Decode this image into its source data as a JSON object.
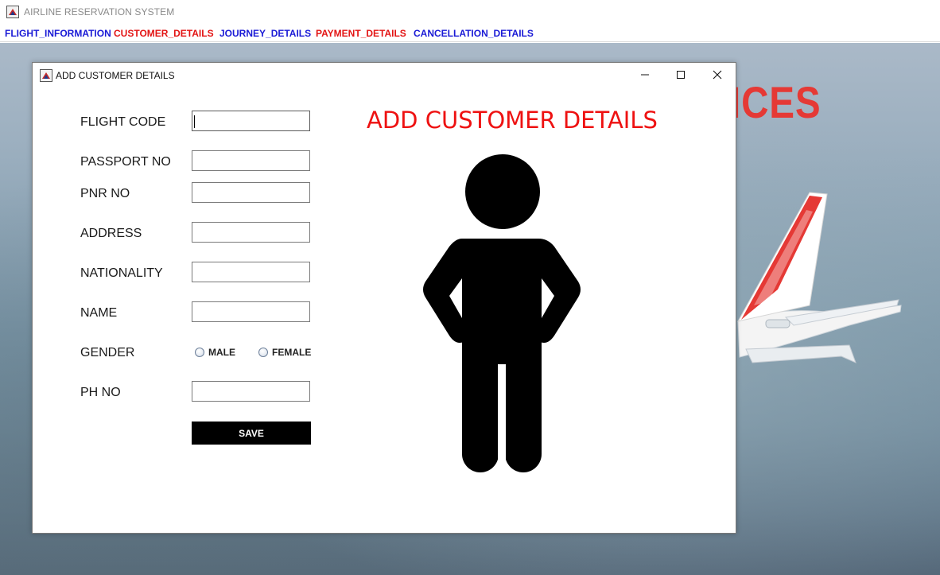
{
  "app": {
    "title": "AIRLINE RESERVATION SYSTEM",
    "icon": "java-app-icon"
  },
  "menu": [
    {
      "label": "FLIGHT_INFORMATION",
      "color": "#1a1ad6"
    },
    {
      "label": "CUSTOMER_DETAILS",
      "color": "#e31414"
    },
    {
      "label": "JOURNEY_DETAILS",
      "color": "#1a1ad6"
    },
    {
      "label": "PAYMENT_DETAILS",
      "color": "#e31414"
    },
    {
      "label": "CANCELLATION_DETAILS",
      "color": "#1a1ad6"
    }
  ],
  "background": {
    "brand_fragment": "ICES"
  },
  "dialog": {
    "title": "ADD CUSTOMER DETAILS",
    "controls": {
      "minimize": "minimize-icon",
      "maximize": "maximize-icon",
      "close": "close-icon"
    }
  },
  "form": {
    "fields": [
      {
        "label": "FLIGHT CODE",
        "value": ""
      },
      {
        "label": "PASSPORT NO",
        "value": ""
      },
      {
        "label": "PNR NO",
        "value": ""
      },
      {
        "label": "ADDRESS",
        "value": ""
      },
      {
        "label": "NATIONALITY",
        "value": ""
      },
      {
        "label": "NAME",
        "value": ""
      },
      {
        "label": "PH NO",
        "value": ""
      }
    ],
    "gender": {
      "label": "GENDER",
      "options": [
        "MALE",
        "FEMALE"
      ],
      "selected": null
    },
    "save_label": "SAVE"
  },
  "heading": "ADD CUSTOMER DETAILS",
  "illustration": "person-icon",
  "colors": {
    "heading": "#ee1111",
    "save_button_bg": "#000000",
    "menu_blue": "#1a1ad6",
    "menu_red": "#e31414"
  }
}
